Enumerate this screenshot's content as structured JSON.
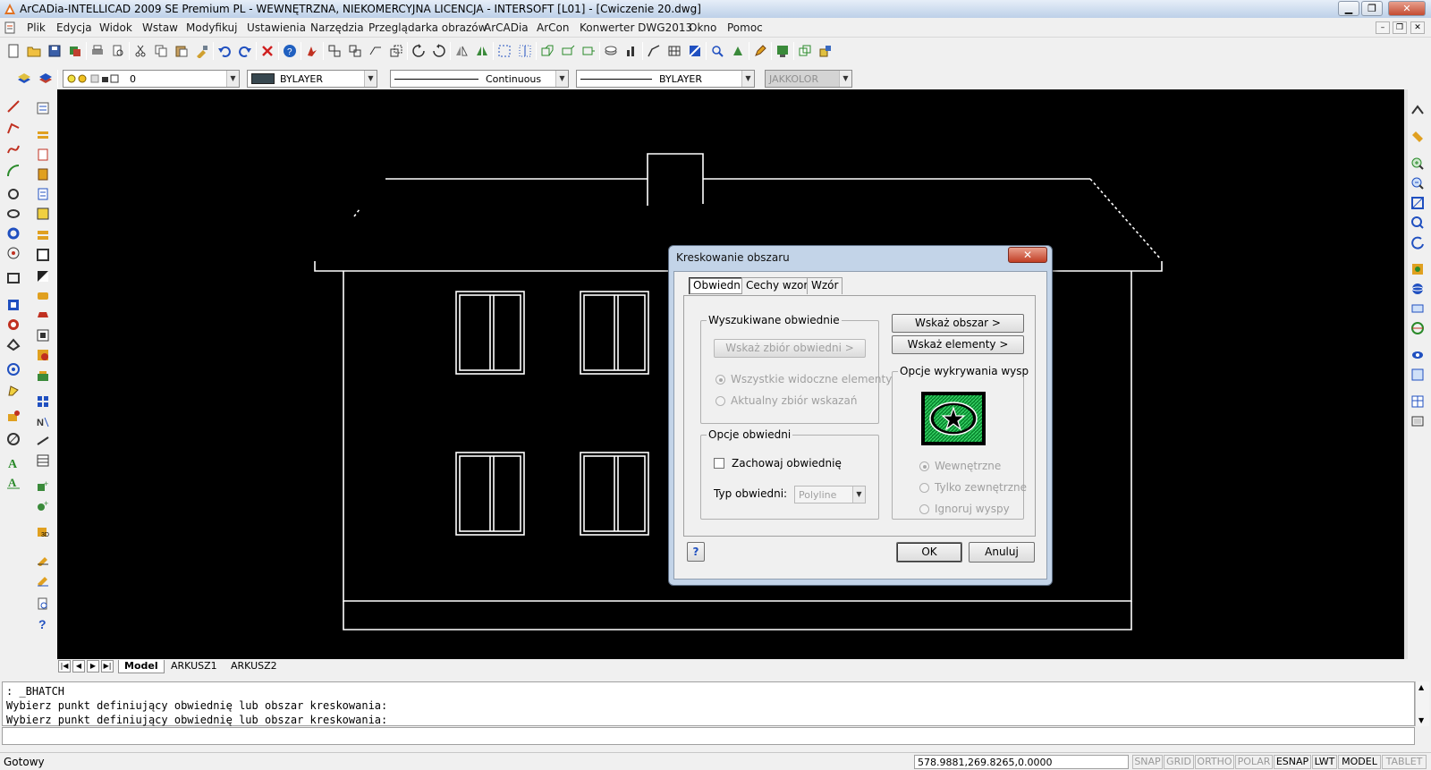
{
  "window": {
    "title": "ArCADia-INTELLICAD 2009 SE Premium PL - WEWNĘTRZNA, NIEKOMERCYJNA LICENCJA - INTERSOFT [L01] - [Cwiczenie 20.dwg]",
    "minimize": "▁",
    "maximize": "❐",
    "close": "✕"
  },
  "menu": {
    "items": [
      "Plik",
      "Edycja",
      "Widok",
      "Wstaw",
      "Modyfikuj",
      "Ustawienia",
      "Narzędzia",
      "Przeglądarka obrazów",
      "ArCADia",
      "ArCon",
      "Konwerter DWG2013",
      "Okno",
      "Pomoc"
    ],
    "mdi_minimize": "–",
    "mdi_restore": "❐",
    "mdi_close": "✕"
  },
  "properties_bar": {
    "layer_value": "0",
    "color_value": "BYLAYER",
    "linetype_value": "Continuous",
    "lineweight_value": "BYLAYER",
    "plotstyle_value": "JAKKOLOR"
  },
  "layout_tabs": {
    "nav": [
      "|◀",
      "◀",
      "▶",
      "▶|"
    ],
    "tabs": [
      "Model",
      "ARKUSZ1",
      "ARKUSZ2"
    ],
    "active": "Model"
  },
  "command": {
    "history": [
      ": _BHATCH",
      "Wybierz punkt definiujący obwiednię lub obszar kreskowania:",
      "Wybierz punkt definiujący obwiednię lub obszar kreskowania:"
    ],
    "input": ""
  },
  "status": {
    "text": "Gotowy",
    "coords": "578.9881,269.8265,0.0000",
    "modes": [
      {
        "label": "SNAP",
        "on": false
      },
      {
        "label": "GRID",
        "on": false
      },
      {
        "label": "ORTHO",
        "on": false
      },
      {
        "label": "POLAR",
        "on": false
      },
      {
        "label": "ESNAP",
        "on": true
      },
      {
        "label": "LWT",
        "on": true
      },
      {
        "label": "MODEL",
        "on": true
      },
      {
        "label": "TABLET",
        "on": false
      }
    ]
  },
  "dialog": {
    "title": "Kreskowanie obszaru",
    "close": "✕",
    "tabs": [
      "Obwiednia",
      "Cechy wzoru",
      "Wzór"
    ],
    "active_tab": "Obwiednia",
    "boundaries_group": {
      "legend": "Wyszukiwane obwiednie",
      "select_set_button": "Wskaż zbiór obwiedni >",
      "radio_all": "Wszystkie widoczne elementy",
      "radio_current": "Aktualny zbiór wskazań"
    },
    "boundary_options_group": {
      "legend": "Opcje obwiedni",
      "keep_boundaries": "Zachowaj obwiednię",
      "type_label": "Typ obwiedni:",
      "type_value": "Polyline"
    },
    "pick_area_button": "Wskaż obszar >",
    "pick_elements_button": "Wskaż elementy >",
    "islands_group": {
      "legend": "Opcje wykrywania wysp",
      "radio_inner": "Wewnętrzne",
      "radio_outer": "Tylko zewnętrzne",
      "radio_ignore": "Ignoruj wyspy"
    },
    "help_button": "?",
    "ok_button": "OK",
    "cancel_button": "Anuluj"
  }
}
